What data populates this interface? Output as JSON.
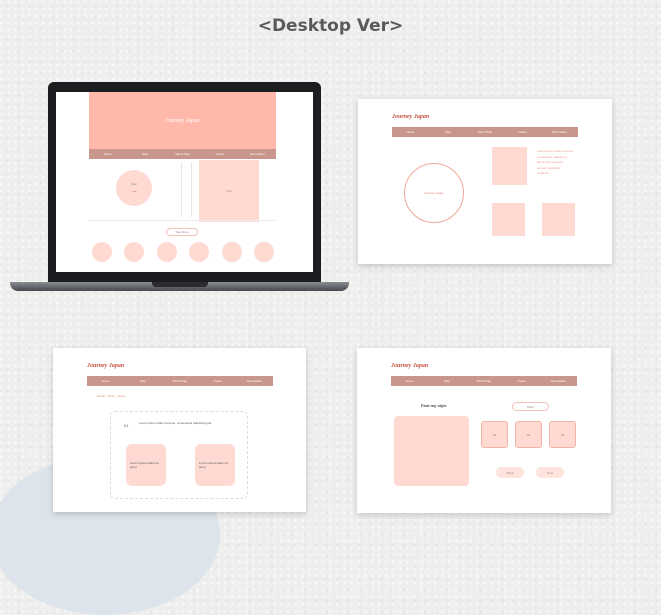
{
  "page_title": "<Desktop Ver>",
  "brand": "Journey Japan",
  "nav_items": [
    "Home",
    "Stay",
    "Eat & Play",
    "Travel",
    "Information"
  ],
  "laptop": {
    "hero_title": "Journey Japan",
    "cta_text": "Start",
    "side_label": "Info",
    "more_label": "See More",
    "dots": [
      "",
      "",
      "",
      "",
      "",
      ""
    ]
  },
  "screen2": {
    "circle_label": "Journey Japan",
    "text_lines": [
      "Lorem ipsum dolor sit amet",
      "consectetur adipiscing",
      "elit sed do eiusmod",
      "tempor incididunt",
      "ut labore"
    ]
  },
  "screen3": {
    "breadcrumb": "Home > Stay > Hotel",
    "number": "01",
    "intro": "Lorem ipsum dolor sit amet, consectetur adipiscing elit.",
    "box1": "Lorem ipsum dolor sit amet",
    "box2": "Lorem ipsum dolor sit amet"
  },
  "screen4": {
    "heading": "Find my style",
    "filter": "Filter",
    "options": [
      "01",
      "02",
      "03"
    ],
    "buttons": [
      "Back",
      "Next"
    ]
  }
}
